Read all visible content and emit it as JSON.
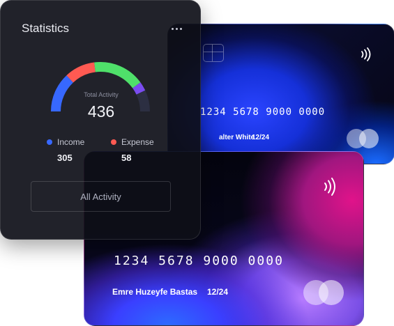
{
  "statistics": {
    "title": "Statistics",
    "menu_icon": "more-horizontal-icon",
    "gauge": {
      "label": "Total Activity",
      "value": "436",
      "segments": [
        {
          "color": "#3768ff",
          "fraction": 0.26
        },
        {
          "color": "#ff5a52",
          "fraction": 0.2
        },
        {
          "color": "#4fe06a",
          "fraction": 0.34
        },
        {
          "color": "#7a4cf0",
          "fraction": 0.06
        },
        {
          "color": "#2c2f42",
          "fraction": 0.14
        }
      ]
    },
    "legend": [
      {
        "label": "Income",
        "value": "305",
        "color": "#3768ff"
      },
      {
        "label": "Expense",
        "value": "58",
        "color": "#ff5a52"
      }
    ],
    "button_label": "All Activity"
  },
  "cards": {
    "back": {
      "number": "1234 5678 9000 0000",
      "holder": "alter White",
      "expiry": "12/24"
    },
    "front": {
      "number": "1234 5678 9000 0000",
      "holder": "Emre Huzeyfe Bastas",
      "expiry": "12/24"
    }
  }
}
